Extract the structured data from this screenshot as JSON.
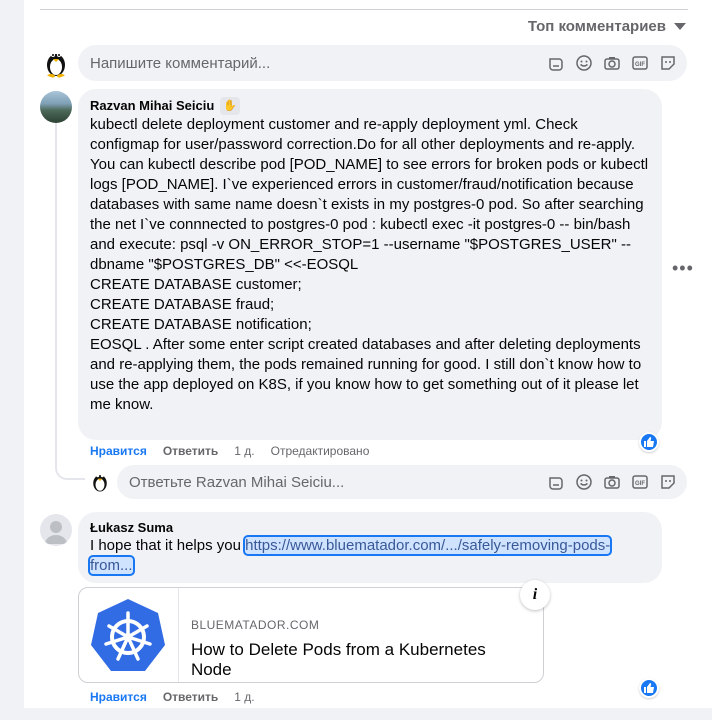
{
  "sort": {
    "label": "Топ комментариев"
  },
  "composer_main": {
    "placeholder": "Напишите комментарий..."
  },
  "comments": [
    {
      "author": "Razvan Mihai Seiciu",
      "text": "kubectl delete deployment customer and re-apply deployment yml. Check configmap for user/password correction.Do for all other deployments and re-apply. You can kubectl describe pod [POD_NAME] to see errors for broken pods or kubectl logs [POD_NAME]. I`ve experienced errors in customer/fraud/notification because databases with same name doesn`t exists in my postgres-0 pod. So after searching the net I`ve connnected to postgres-0 pod : kubectl exec -it postgres-0 -- bin/bash and execute: psql -v ON_ERROR_STOP=1 --username \"$POSTGRES_USER\" --dbname \"$POSTGRES_DB\" <<-EOSQL\nCREATE DATABASE customer;\nCREATE DATABASE fraud;\nCREATE DATABASE notification;\nEOSQL . After some enter script created databases and after deleting deployments and re-applying them, the pods remained running for good. I still don`t know how to use the app deployed on K8S, if you know how to get something out of it please let me know.",
      "like": "Нравится",
      "reply": "Ответить",
      "time": "1 д.",
      "edited": "Отредактировано"
    },
    {
      "author": "Łukasz Suma",
      "text": "I hope that it helps you ",
      "link": "https://www.bluematador.com/.../safely-removing-pods-from...",
      "like": "Нравится",
      "reply": "Ответить",
      "time": "1 д."
    }
  ],
  "reply_composer": {
    "placeholder": "Ответьте Razvan Mihai Seiciu..."
  },
  "link_preview": {
    "domain": "BLUEMATADOR.COM",
    "title": "How to Delete Pods from a Kubernetes Node"
  },
  "colors": {
    "accent": "#1877f2",
    "bubble": "#f0f2f5",
    "kubernetes": "#326ce5"
  }
}
